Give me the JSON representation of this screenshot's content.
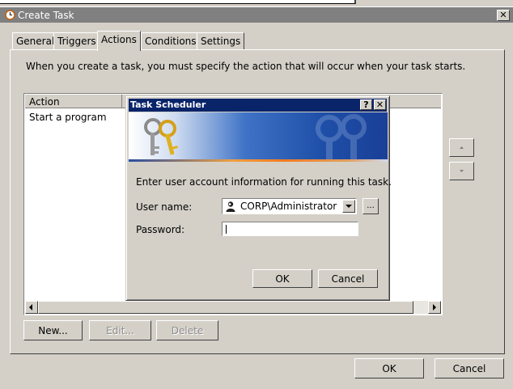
{
  "window": {
    "title": "Create Task"
  },
  "tabs": [
    {
      "label": "General"
    },
    {
      "label": "Triggers"
    },
    {
      "label": "Actions",
      "active": true
    },
    {
      "label": "Conditions"
    },
    {
      "label": "Settings"
    }
  ],
  "actions_tab": {
    "description": "When you create a task, you must specify the action that will occur when your task starts.",
    "list": {
      "columns": [
        "Action"
      ],
      "rows": [
        {
          "action": "Start a program"
        }
      ]
    },
    "buttons": {
      "new": "New...",
      "edit": "Edit...",
      "delete": "Delete"
    }
  },
  "footer": {
    "ok": "OK",
    "cancel": "Cancel"
  },
  "dialog": {
    "title": "Task Scheduler",
    "help_button": "?",
    "prompt": "Enter user account information for running this task.",
    "username_label": "User name:",
    "username_value": "CORP\\Administrator",
    "browse_button": "...",
    "password_label": "Password:",
    "password_value": "",
    "ok": "OK",
    "cancel": "Cancel"
  },
  "colors": {
    "dialog_titlebar": "#0a246a",
    "window_titlebar_inactive": "#808080",
    "face": "#d4d0c8"
  },
  "icons": [
    "task-clock-icon",
    "keys-icon",
    "user-icon",
    "close-icon",
    "help-icon",
    "scroll-left-icon",
    "scroll-right-icon",
    "move-up-icon",
    "move-down-icon",
    "dropdown-arrow-icon"
  ]
}
